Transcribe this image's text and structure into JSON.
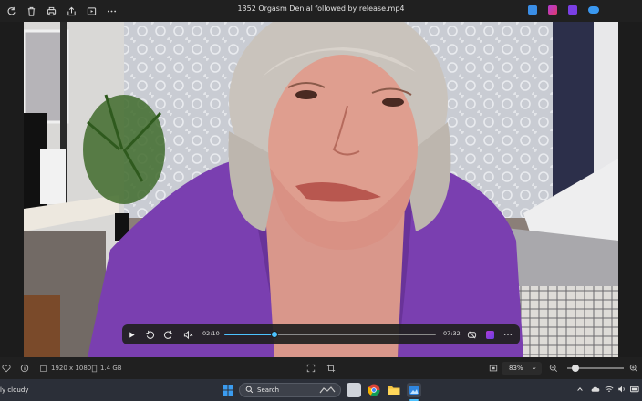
{
  "window": {
    "title": "1352 Orgasm Denial followed by release.mp4",
    "icons": [
      "rotate-icon",
      "delete-icon",
      "print-icon",
      "share-icon",
      "slideshow-icon",
      "more-icon"
    ],
    "app_icons": [
      "photos-app-icon",
      "clipchamp-app-icon",
      "video-app-icon",
      "onedrive-icon"
    ]
  },
  "player": {
    "current_time": "02:10",
    "total_time": "07:32",
    "progress_fraction": 0.235,
    "icons": [
      "play-icon",
      "rewind-10-icon",
      "forward-30-icon",
      "mute-icon",
      "loop-icon",
      "clipchamp-icon",
      "more-icon"
    ]
  },
  "statusbar": {
    "dimensions": "1920 x 1080",
    "file_size": "1.4 GB",
    "zoom": "83%",
    "zoom_fraction": 0.15
  },
  "taskbar": {
    "weather": "ly cloudy",
    "search_label": "Search"
  },
  "colors": {
    "accent": "#4cc2ff",
    "titlebar": "#202020",
    "taskbar": "#2b2f38"
  }
}
